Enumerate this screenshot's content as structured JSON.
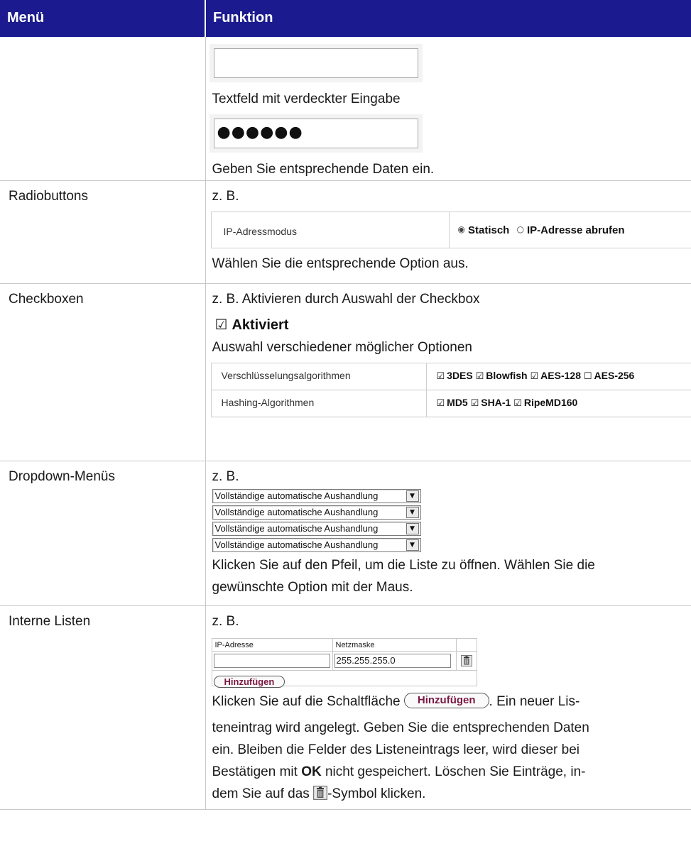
{
  "header": {
    "col_menu": "Menü",
    "col_function": "Funktion"
  },
  "row_text": {
    "label_masked": "Textfeld mit verdeckter Eingabe",
    "masked_value": "●●●●●●",
    "instruction": "Geben Sie entsprechende Daten ein."
  },
  "row_radio": {
    "menu": "Radiobuttons",
    "example": "z. B.",
    "field_label": "IP-Adressmodus",
    "option_1": "Statisch",
    "option_2": "IP-Adresse abrufen",
    "selected": "Statisch",
    "instruction": "Wählen Sie die entsprechende Option aus."
  },
  "row_check": {
    "menu": "Checkboxen",
    "example": "z. B. Aktivieren durch Auswahl der Checkbox",
    "aktiv_label": "Aktiviert",
    "multi_label": "Auswahl verschiedener möglicher Optionen",
    "enc_label": "Verschlüsselungsalgorithmen",
    "enc_opt_1": "3DES",
    "enc_opt_2": "Blowfish",
    "enc_opt_3": "AES-128",
    "enc_opt_4": "AES-256",
    "hash_label": "Hashing-Algorithmen",
    "hash_opt_1": "MD5",
    "hash_opt_2": "SHA-1",
    "hash_opt_3": "RipeMD160"
  },
  "row_dropdown": {
    "menu": "Dropdown-Menüs",
    "example": "z. B.",
    "option": "Vollständige automatische Aushandlung",
    "instruction_1": "Klicken Sie auf den Pfeil, um die Liste zu öffnen. Wählen Sie die",
    "instruction_2": "gewünschte Option mit der Maus."
  },
  "row_list": {
    "menu": "Interne Listen",
    "example": "z. B.",
    "col_ip": "IP-Adresse",
    "col_mask": "Netzmaske",
    "ip_value": "",
    "mask_value": "255.255.255.0",
    "add_button": "Hinzufügen",
    "text_1": "Klicken Sie auf die Schaltfläche",
    "text_2": ". Ein neuer Lis-",
    "text_3": "teneintrag wird angelegt. Geben Sie die entsprechenden Daten",
    "text_4": "ein. Bleiben die Felder des Listeneintrags leer, wird dieser bei",
    "text_5a": "Bestätigen mit",
    "text_5_ok": "OK",
    "text_5b": "nicht gespeichert. Löschen Sie Einträge, in-",
    "text_6a": "dem Sie auf das",
    "text_6b": "-Symbol klicken."
  },
  "icons": {
    "trash": "trash-icon",
    "checkbox": "checkbox-icon",
    "radio": "radio-icon",
    "dropdown_arrow": "chevron-down-icon"
  },
  "colors": {
    "header_bg": "#1b1b8f",
    "header_text": "#ffffff",
    "button_text": "#7a1840",
    "rule": "#c9c9c9"
  }
}
